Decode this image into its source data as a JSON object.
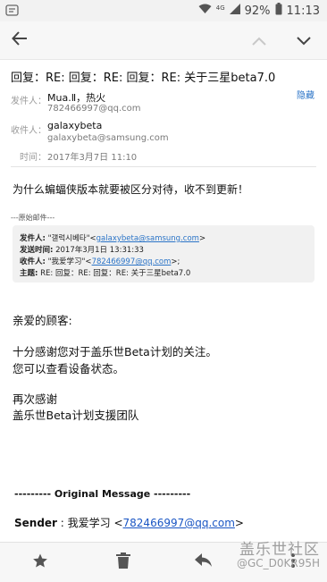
{
  "status": {
    "signal_label": "4G",
    "battery": "92%",
    "time": "11:13"
  },
  "email": {
    "subject": "回复：RE: 回复：RE: 回复：RE: 关于三星beta7.0",
    "from_label": "发件人：",
    "from_name": "Mua.Ⅱ，热火",
    "from_addr": "782466997@qq.com",
    "hide_label": "隐藏",
    "to_label": "收件人：",
    "to_name": "galaxybeta",
    "to_addr": "galaxybeta@samsung.com",
    "time_label": "时间：",
    "time_value": "2017年3月7日 11:10",
    "body_question": "为什么蝙蝠侠版本就要被区分对待，收不到更新！",
    "original_sep": "---原始邮件---",
    "quote": {
      "from_label": "发件人:",
      "from_name": " \"갤럭시베타\"<",
      "from_email": "galaxybeta@samsung.com",
      "from_end": ">",
      "time_label": "发送时间:",
      "time_value": " 2017年3月1日 13:31:33",
      "to_label": "收件人:",
      "to_name": " \"我爱学习\"<",
      "to_email": "782466997@qq.com",
      "to_end": ">;",
      "subject_label": "主题:",
      "subject_value": " RE: 回复：RE: 回复：RE: 关于三星beta7.0"
    },
    "greeting": "亲爱的顾客:",
    "line1": "十分感谢您对于盖乐世Beta计划的关注。",
    "line2": "您可以查看设备状态。",
    "thanks": "再次感谢",
    "team": "盖乐世Beta计划支援团队",
    "original_message": "--------- Original Message ---------",
    "sender_label": "Sender",
    "sender_mid": " : 我爱学习 <",
    "sender_email": "782466997@qq.com",
    "sender_end": ">"
  },
  "watermark": {
    "line1": "盖乐世社区",
    "line2": "@GC_D0KR95H"
  },
  "icons": [
    "whatsapp-icon",
    "wifi-icon",
    "signal-icon",
    "battery-icon",
    "back-arrow-icon",
    "chevron-up-icon",
    "chevron-down-icon",
    "star-icon",
    "trash-icon",
    "reply-icon",
    "more-vert-icon"
  ],
  "colors": {
    "link": "#2b74c7",
    "icon": "#555555",
    "accent": "#1a56c4"
  }
}
